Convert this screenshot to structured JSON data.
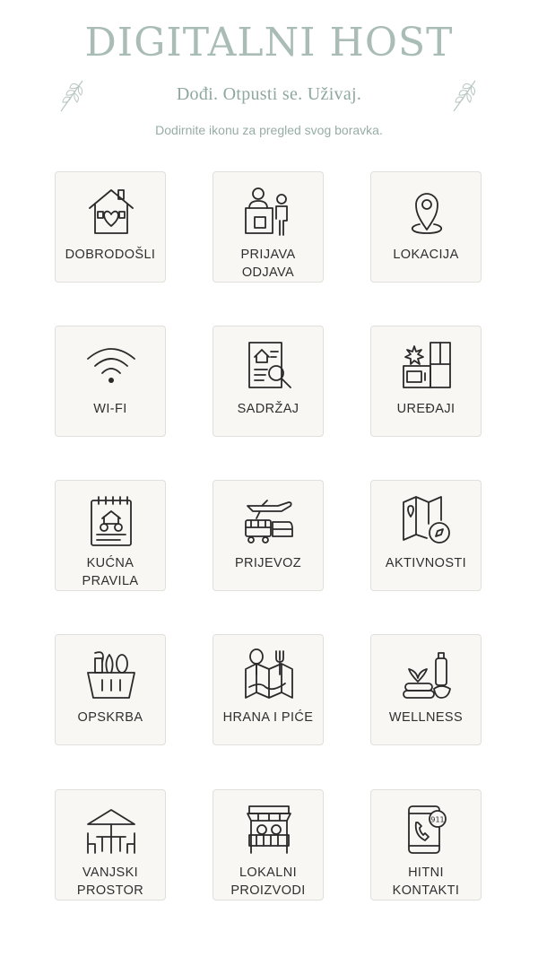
{
  "header": {
    "title": "DIGITALNI HOST",
    "tagline": "Dođi. Otpusti se. Uživaj.",
    "subtitle": "Dodirnite ikonu za pregled svog boravka."
  },
  "colors": {
    "accent": "#a9bcb5",
    "tile_bg": "#f8f7f4",
    "tile_border": "#e0dfdb"
  },
  "tiles": [
    {
      "line1": "DOBRODOŠLI",
      "line2": "",
      "icon": "house-heart-icon"
    },
    {
      "line1": "PRIJAVA",
      "line2": "ODJAVA",
      "icon": "reception-desk-icon"
    },
    {
      "line1": "LOKACIJA",
      "line2": "",
      "icon": "location-pin-icon"
    },
    {
      "line1": "WI-FI",
      "line2": "",
      "icon": "wifi-icon"
    },
    {
      "line1": "SADRŽAJ",
      "line2": "",
      "icon": "house-document-search-icon"
    },
    {
      "line1": "UREĐAJI",
      "line2": "",
      "icon": "appliances-icon"
    },
    {
      "line1": "KUĆNA",
      "line2": "PRAVILA",
      "icon": "house-rules-notepad-icon"
    },
    {
      "line1": "PRIJEVOZ",
      "line2": "",
      "icon": "transport-icon"
    },
    {
      "line1": "AKTIVNOSTI",
      "line2": "",
      "icon": "map-compass-icon"
    },
    {
      "line1": "OPSKRBA",
      "line2": "",
      "icon": "grocery-basket-icon"
    },
    {
      "line1": "HRANA I PIĆE",
      "line2": "",
      "icon": "food-map-icon"
    },
    {
      "line1": "WELLNESS",
      "line2": "",
      "icon": "spa-wellness-icon"
    },
    {
      "line1": "VANJSKI",
      "line2": "PROSTOR",
      "icon": "patio-umbrella-icon"
    },
    {
      "line1": "LOKALNI",
      "line2": "PROIZVODI",
      "icon": "market-stall-icon"
    },
    {
      "line1": "HITNI",
      "line2": "KONTAKTI",
      "icon": "emergency-phone-icon"
    }
  ]
}
